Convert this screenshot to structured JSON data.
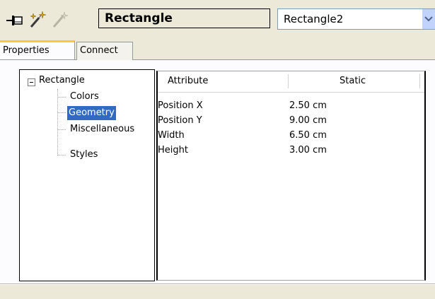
{
  "toolbar": {
    "icons": [
      "pin-icon",
      "magic-wand-icon",
      "magic-wand-disabled-icon"
    ],
    "object_name": "Rectangle",
    "object_selector": {
      "selected": "Rectangle2"
    }
  },
  "tabs": [
    {
      "label": "Properties",
      "active": true
    },
    {
      "label": "Connect",
      "active": false
    }
  ],
  "tree": {
    "root": "Rectangle",
    "items": [
      {
        "label": "Colors",
        "selected": false
      },
      {
        "label": "Geometry",
        "selected": true
      },
      {
        "label": "Miscellaneous",
        "selected": false
      },
      {
        "label": "Styles",
        "selected": false
      }
    ]
  },
  "grid": {
    "columns": [
      "Attribute",
      "Static"
    ],
    "rows": [
      {
        "attribute": "Position X",
        "value": "2.50 cm"
      },
      {
        "attribute": "Position Y",
        "value": "9.00 cm"
      },
      {
        "attribute": "Width",
        "value": "6.50 cm"
      },
      {
        "attribute": "Height",
        "value": "3.00 cm"
      }
    ]
  },
  "colors": {
    "window_bg": "#ece9d8",
    "selection": "#316ac5",
    "active_tab_accent": "#ffc83c"
  }
}
